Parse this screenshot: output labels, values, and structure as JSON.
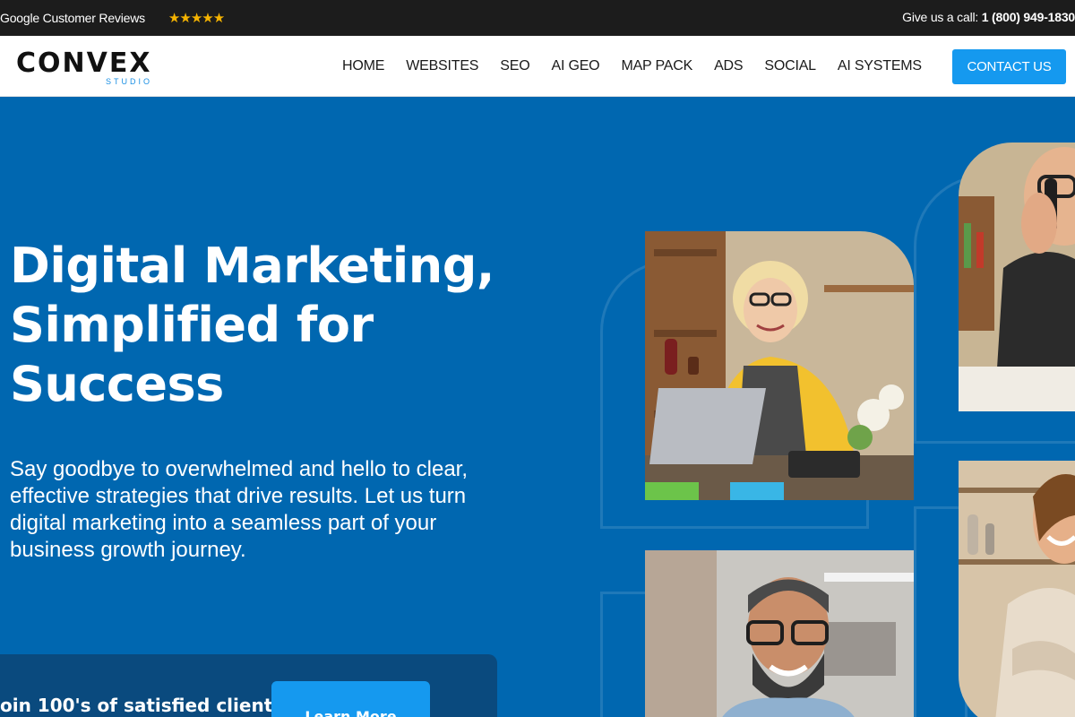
{
  "topbar": {
    "reviews_label": "Google Customer Reviews",
    "stars": "★★★★★",
    "call_label": "Give us a call: ",
    "phone": "1 (800) 949-1830"
  },
  "header": {
    "logo_main": "CONVEX",
    "logo_sub": "STUDIO",
    "nav": [
      "HOME",
      "WEBSITES",
      "SEO",
      "AI GEO",
      "MAP PACK",
      "ADS",
      "SOCIAL",
      "AI SYSTEMS"
    ],
    "contact_label": "CONTACT US"
  },
  "hero": {
    "title_line1": "Digital Marketing,",
    "title_line2": "Simplified for",
    "title_line3": "Success",
    "subtitle": "Say goodbye to overwhelmed and hello to clear, effective strategies that drive results. Let us turn digital marketing into a seamless part of your business growth journey.",
    "cta_text": "oin 100's of satisfied clients",
    "learn_more": "Learn More"
  },
  "colors": {
    "hero_bg": "#0067b0",
    "accent": "#1599ef",
    "topbar_bg": "#1c1c1c",
    "star": "#f5b301"
  }
}
